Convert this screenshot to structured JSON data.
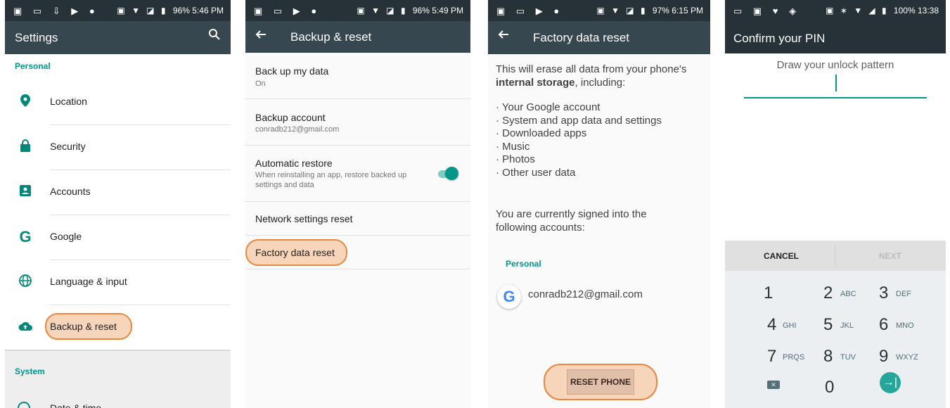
{
  "panel1": {
    "status": {
      "left_icons": "▣ ▭ ⇩ ▶ ●",
      "system_icons": "▣ ▼ ◪ ▮",
      "battery": "96%",
      "time": "5:46 PM"
    },
    "title": "Settings",
    "section_personal": "Personal",
    "items": [
      {
        "label": "Location",
        "icon": "location-pin-icon"
      },
      {
        "label": "Security",
        "icon": "lock-icon"
      },
      {
        "label": "Accounts",
        "icon": "account-box-icon"
      },
      {
        "label": "Google",
        "icon": "google-g-icon"
      },
      {
        "label": "Language & input",
        "icon": "globe-icon"
      },
      {
        "label": "Backup & reset",
        "icon": "cloud-upload-icon"
      }
    ],
    "section_system": "System",
    "partial_item": "Date & time"
  },
  "panel2": {
    "status": {
      "left_icons": "▣ ▭ ▶ ●",
      "system_icons": "▣ ▼ ◪ ▮",
      "battery": "96%",
      "time": "5:49 PM"
    },
    "title": "Backup & reset",
    "items": [
      {
        "title": "Back up my data",
        "subtitle": "On"
      },
      {
        "title": "Backup account",
        "subtitle": "conradb212@gmail.com"
      },
      {
        "title": "Automatic restore",
        "subtitle": "When reinstalling an app, restore backed up settings and data",
        "toggle_on": true
      },
      {
        "title": "Network settings reset"
      },
      {
        "title": "Factory data reset"
      }
    ]
  },
  "panel3": {
    "status": {
      "left_icons": "▣ ▭ ▶ ●",
      "system_icons": "▣ ▼ ◪ ▮",
      "battery": "97%",
      "time": "6:15 PM"
    },
    "title": "Factory data reset",
    "intro_before": "This will erase all data from your phone's",
    "intro_bold": "internal storage",
    "intro_after": ", including:",
    "bullets": [
      "Your Google account",
      "System and app data and settings",
      "Downloaded apps",
      "Music",
      "Photos",
      "Other user data"
    ],
    "signed_in_text": "You are currently signed into the following accounts:",
    "section_personal": "Personal",
    "account_email": "conradb212@gmail.com",
    "reset_button": "RESET PHONE"
  },
  "panel4": {
    "status": {
      "left_icons": "▭ ▣ ♥ ◈",
      "system_icons": "▣ ∗ ▼ ◢ ▮",
      "battery": "100%",
      "time": "13:38"
    },
    "title": "Confirm your PIN",
    "prompt": "Draw your unlock pattern",
    "cancel": "CANCEL",
    "next": "NEXT",
    "keys": [
      {
        "digit": "1",
        "letters": ""
      },
      {
        "digit": "2",
        "letters": "ABC"
      },
      {
        "digit": "3",
        "letters": "DEF"
      },
      {
        "digit": "4",
        "letters": "GHI"
      },
      {
        "digit": "5",
        "letters": "JKL"
      },
      {
        "digit": "6",
        "letters": "MNO"
      },
      {
        "digit": "7",
        "letters": "PRQS"
      },
      {
        "digit": "8",
        "letters": "TUV"
      },
      {
        "digit": "9",
        "letters": "WXYZ"
      },
      {
        "digit": "0",
        "letters": ""
      }
    ]
  },
  "colors": {
    "accent": "#009688",
    "appbar": "#37474f",
    "statusbar": "#263238",
    "highlight": "#e8883e"
  }
}
